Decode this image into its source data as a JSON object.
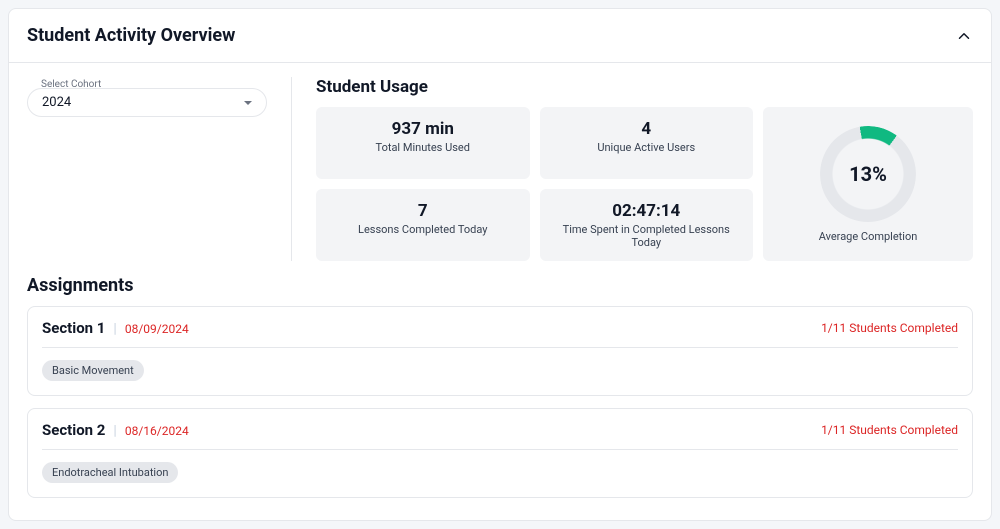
{
  "header": {
    "title": "Student Activity Overview"
  },
  "cohort": {
    "label": "Select Cohort",
    "value": "2024"
  },
  "usage": {
    "title": "Student Usage",
    "cards": [
      {
        "value": "937 min",
        "label": "Total Minutes Used"
      },
      {
        "value": "4",
        "label": "Unique Active Users"
      },
      {
        "value": "7",
        "label": "Lessons Completed Today"
      },
      {
        "value": "02:47:14",
        "label": "Time Spent in Completed Lessons Today"
      }
    ],
    "completion": {
      "percent_text": "13%",
      "label": "Average Completion"
    }
  },
  "assignments": {
    "title": "Assignments",
    "items": [
      {
        "section": "Section 1",
        "date": "08/09/2024",
        "status": "1/11 Students Completed",
        "tag": "Basic Movement"
      },
      {
        "section": "Section 2",
        "date": "08/16/2024",
        "status": "1/11 Students Completed",
        "tag": "Endotracheal Intubation"
      }
    ]
  }
}
